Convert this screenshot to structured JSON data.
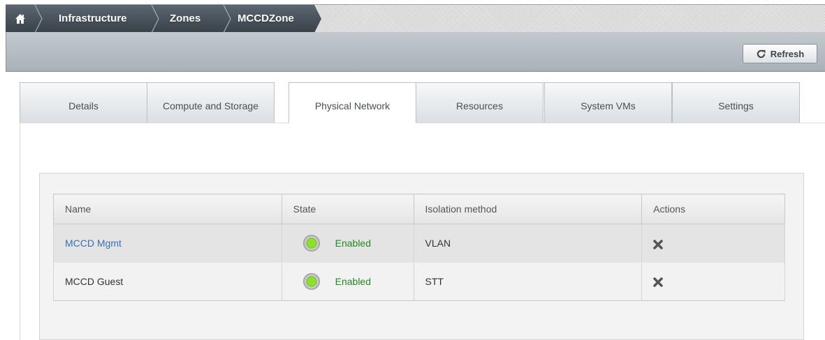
{
  "breadcrumb": {
    "home_icon": "home-icon",
    "items": [
      "Infrastructure",
      "Zones",
      "MCCDZone"
    ]
  },
  "toolbar": {
    "refresh_label": "Refresh",
    "refresh_icon": "refresh-icon"
  },
  "tabs": [
    {
      "label": "Details",
      "active": false
    },
    {
      "label": "Compute and Storage",
      "active": false
    },
    {
      "label": "Physical Network",
      "active": true
    },
    {
      "label": "Resources",
      "active": false
    },
    {
      "label": "System VMs",
      "active": false
    },
    {
      "label": "Settings",
      "active": false
    }
  ],
  "table": {
    "columns": [
      "Name",
      "State",
      "Isolation method",
      "Actions"
    ],
    "rows": [
      {
        "name": "MCCD Mgmt",
        "state": "Enabled",
        "isolation": "VLAN",
        "action_icon": "remove-icon"
      },
      {
        "name": "MCCD Guest",
        "state": "Enabled",
        "isolation": "STT",
        "action_icon": "remove-icon"
      }
    ]
  },
  "colors": {
    "breadcrumb_dark": "#3f4a52",
    "link": "#3b6fb5",
    "enabled": "#1f8a1f",
    "status_green": "#8ee02f"
  }
}
